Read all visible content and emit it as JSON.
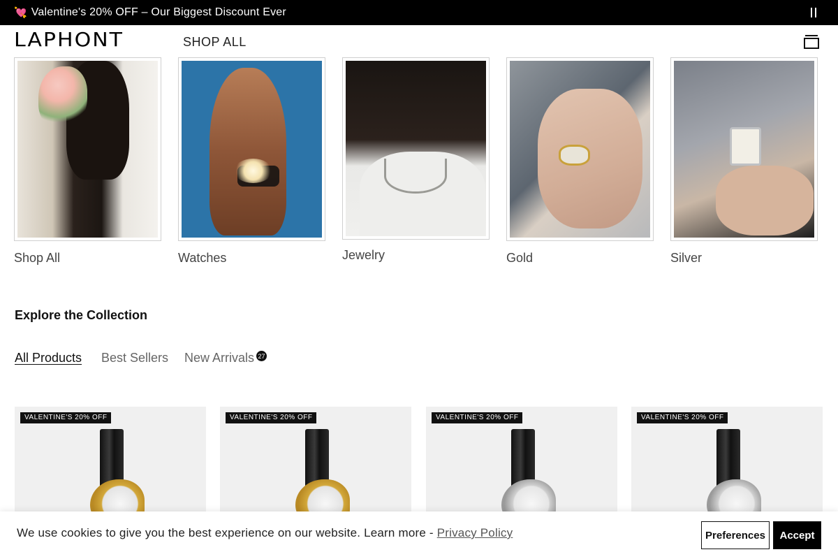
{
  "announcement": {
    "heart": "💘",
    "text": "Valentine's 20% OFF – Our Biggest Discount Ever"
  },
  "header": {
    "logo": "LAPHONT",
    "nav_shop_all": "SHOP ALL"
  },
  "categories": [
    {
      "label": "Shop All"
    },
    {
      "label": "Watches"
    },
    {
      "label": "Jewelry"
    },
    {
      "label": "Gold"
    },
    {
      "label": "Silver"
    }
  ],
  "collection": {
    "title": "Explore the Collection",
    "tabs": [
      {
        "label": "All Products",
        "active": true
      },
      {
        "label": "Best Sellers",
        "active": false
      },
      {
        "label": "New Arrivals",
        "active": false
      }
    ],
    "new_arrivals_count": "27"
  },
  "products": [
    {
      "badge": "VALENTINE'S 20% OFF",
      "finish": "gold"
    },
    {
      "badge": "VALENTINE'S 20% OFF",
      "finish": "gold"
    },
    {
      "badge": "VALENTINE'S 20% OFF",
      "finish": "silver"
    },
    {
      "badge": "VALENTINE'S 20% OFF",
      "finish": "silver"
    }
  ],
  "cookie_banner": {
    "text": "We use cookies to give you the best experience on our website. Learn more - ",
    "link": "Privacy Policy",
    "preferences_label": "Preferences",
    "accept_label": "Accept"
  }
}
